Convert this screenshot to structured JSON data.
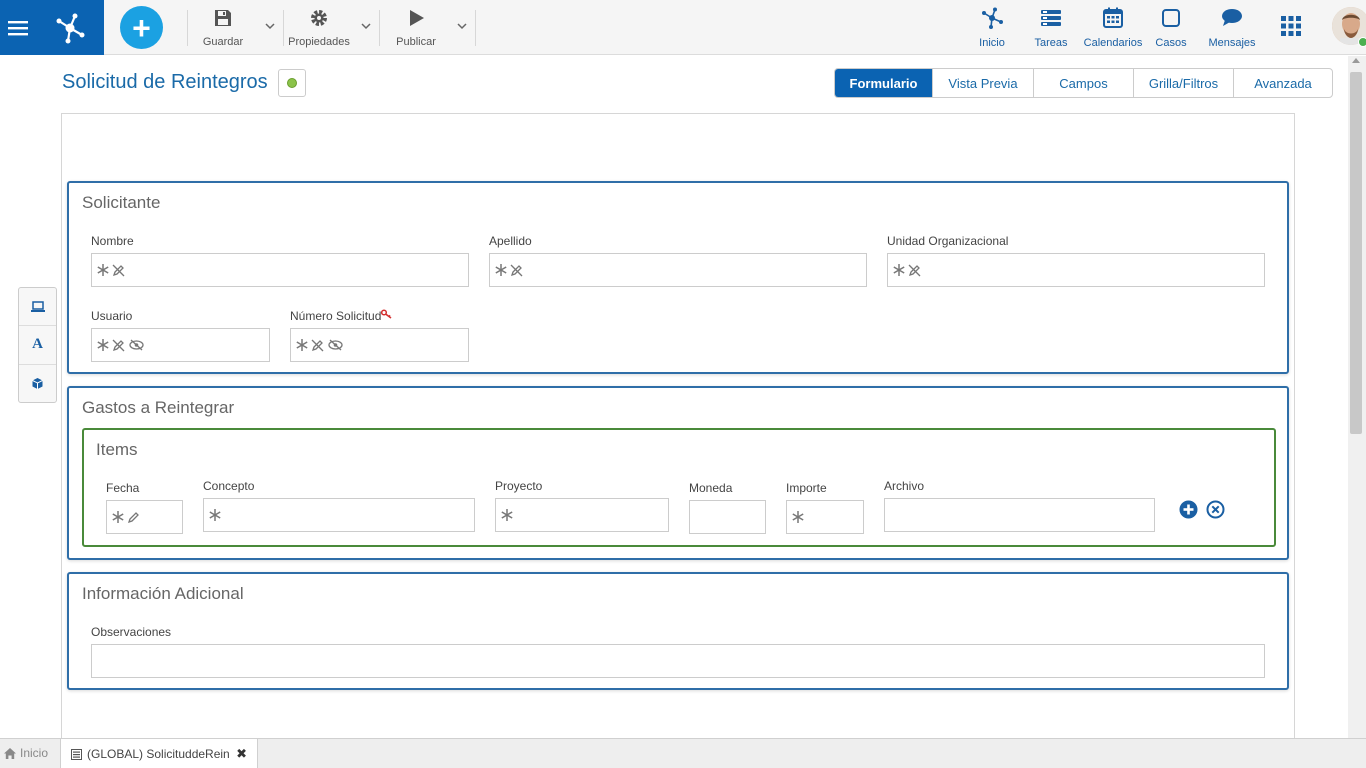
{
  "toolbar": {
    "save_label": "Guardar",
    "properties_label": "Propiedades",
    "publish_label": "Publicar"
  },
  "nav": {
    "items": [
      {
        "label": "Inicio",
        "icon": "network-icon"
      },
      {
        "label": "Tareas",
        "icon": "tasks-icon"
      },
      {
        "label": "Calendarios",
        "icon": "calendar-icon"
      },
      {
        "label": "Casos",
        "icon": "cases-icon"
      },
      {
        "label": "Mensajes",
        "icon": "message-icon"
      }
    ]
  },
  "page": {
    "title": "Solicitud de Reintegros",
    "status_color": "#8bc34a"
  },
  "tabs": [
    {
      "label": "Formulario",
      "active": true
    },
    {
      "label": "Vista Previa",
      "active": false
    },
    {
      "label": "Campos",
      "active": false
    },
    {
      "label": "Grilla/Filtros",
      "active": false
    },
    {
      "label": "Avanzada",
      "active": false
    }
  ],
  "side_tools": [
    "monitor-icon",
    "text-icon",
    "box-icon"
  ],
  "side_tool_text": "A",
  "sections": {
    "solicitante": {
      "title": "Solicitante",
      "fields": {
        "nombre": "Nombre",
        "apellido": "Apellido",
        "unidad": "Unidad Organizacional",
        "usuario": "Usuario",
        "numero": "Número Solicitud"
      }
    },
    "gastos": {
      "title": "Gastos a Reintegrar",
      "items": {
        "title": "Items",
        "columns": {
          "fecha": "Fecha",
          "concepto": "Concepto",
          "proyecto": "Proyecto",
          "moneda": "Moneda",
          "importe": "Importe",
          "archivo": "Archivo"
        }
      }
    },
    "info": {
      "title": "Información Adicional",
      "fields": {
        "observaciones": "Observaciones"
      }
    }
  },
  "bottom": {
    "home_label": "Inicio",
    "active_tab_label": "(GLOBAL) SolicituddeRein"
  },
  "colors": {
    "primary": "#0b63b2",
    "accent": "#1ba1e2",
    "section_border": "#2f6ea8",
    "subsection_border": "#4a8a3a"
  }
}
